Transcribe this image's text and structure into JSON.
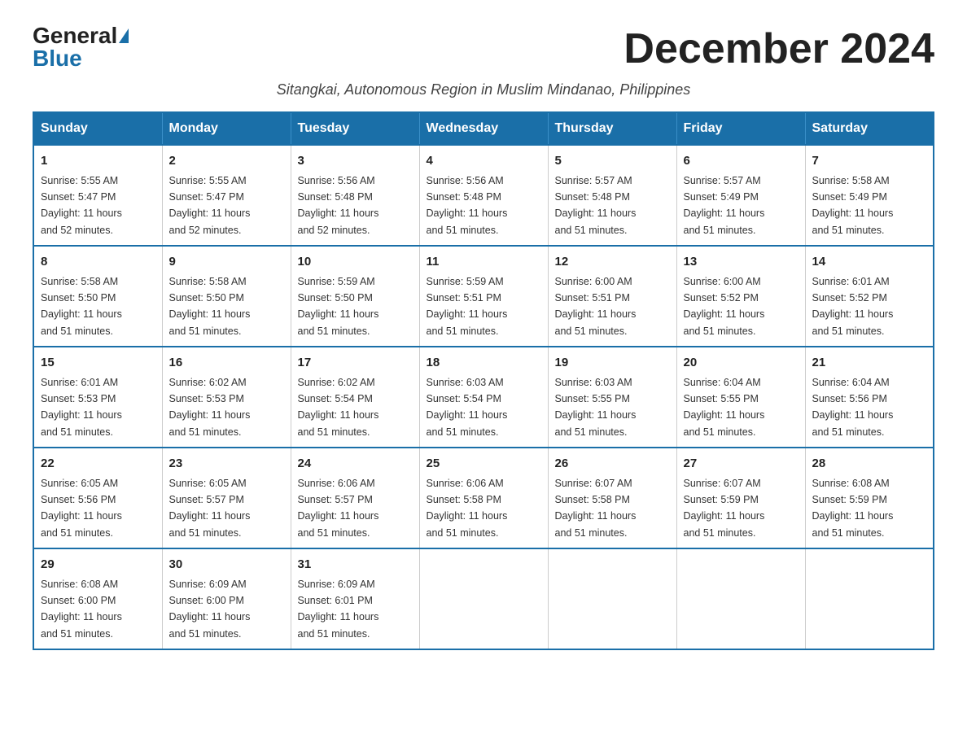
{
  "logo": {
    "general": "General",
    "blue": "Blue"
  },
  "title": "December 2024",
  "subtitle": "Sitangkai, Autonomous Region in Muslim Mindanao, Philippines",
  "days_of_week": [
    "Sunday",
    "Monday",
    "Tuesday",
    "Wednesday",
    "Thursday",
    "Friday",
    "Saturday"
  ],
  "weeks": [
    [
      {
        "day": "1",
        "sunrise": "5:55 AM",
        "sunset": "5:47 PM",
        "daylight": "11 hours and 52 minutes."
      },
      {
        "day": "2",
        "sunrise": "5:55 AM",
        "sunset": "5:47 PM",
        "daylight": "11 hours and 52 minutes."
      },
      {
        "day": "3",
        "sunrise": "5:56 AM",
        "sunset": "5:48 PM",
        "daylight": "11 hours and 52 minutes."
      },
      {
        "day": "4",
        "sunrise": "5:56 AM",
        "sunset": "5:48 PM",
        "daylight": "11 hours and 51 minutes."
      },
      {
        "day": "5",
        "sunrise": "5:57 AM",
        "sunset": "5:48 PM",
        "daylight": "11 hours and 51 minutes."
      },
      {
        "day": "6",
        "sunrise": "5:57 AM",
        "sunset": "5:49 PM",
        "daylight": "11 hours and 51 minutes."
      },
      {
        "day": "7",
        "sunrise": "5:58 AM",
        "sunset": "5:49 PM",
        "daylight": "11 hours and 51 minutes."
      }
    ],
    [
      {
        "day": "8",
        "sunrise": "5:58 AM",
        "sunset": "5:50 PM",
        "daylight": "11 hours and 51 minutes."
      },
      {
        "day": "9",
        "sunrise": "5:58 AM",
        "sunset": "5:50 PM",
        "daylight": "11 hours and 51 minutes."
      },
      {
        "day": "10",
        "sunrise": "5:59 AM",
        "sunset": "5:50 PM",
        "daylight": "11 hours and 51 minutes."
      },
      {
        "day": "11",
        "sunrise": "5:59 AM",
        "sunset": "5:51 PM",
        "daylight": "11 hours and 51 minutes."
      },
      {
        "day": "12",
        "sunrise": "6:00 AM",
        "sunset": "5:51 PM",
        "daylight": "11 hours and 51 minutes."
      },
      {
        "day": "13",
        "sunrise": "6:00 AM",
        "sunset": "5:52 PM",
        "daylight": "11 hours and 51 minutes."
      },
      {
        "day": "14",
        "sunrise": "6:01 AM",
        "sunset": "5:52 PM",
        "daylight": "11 hours and 51 minutes."
      }
    ],
    [
      {
        "day": "15",
        "sunrise": "6:01 AM",
        "sunset": "5:53 PM",
        "daylight": "11 hours and 51 minutes."
      },
      {
        "day": "16",
        "sunrise": "6:02 AM",
        "sunset": "5:53 PM",
        "daylight": "11 hours and 51 minutes."
      },
      {
        "day": "17",
        "sunrise": "6:02 AM",
        "sunset": "5:54 PM",
        "daylight": "11 hours and 51 minutes."
      },
      {
        "day": "18",
        "sunrise": "6:03 AM",
        "sunset": "5:54 PM",
        "daylight": "11 hours and 51 minutes."
      },
      {
        "day": "19",
        "sunrise": "6:03 AM",
        "sunset": "5:55 PM",
        "daylight": "11 hours and 51 minutes."
      },
      {
        "day": "20",
        "sunrise": "6:04 AM",
        "sunset": "5:55 PM",
        "daylight": "11 hours and 51 minutes."
      },
      {
        "day": "21",
        "sunrise": "6:04 AM",
        "sunset": "5:56 PM",
        "daylight": "11 hours and 51 minutes."
      }
    ],
    [
      {
        "day": "22",
        "sunrise": "6:05 AM",
        "sunset": "5:56 PM",
        "daylight": "11 hours and 51 minutes."
      },
      {
        "day": "23",
        "sunrise": "6:05 AM",
        "sunset": "5:57 PM",
        "daylight": "11 hours and 51 minutes."
      },
      {
        "day": "24",
        "sunrise": "6:06 AM",
        "sunset": "5:57 PM",
        "daylight": "11 hours and 51 minutes."
      },
      {
        "day": "25",
        "sunrise": "6:06 AM",
        "sunset": "5:58 PM",
        "daylight": "11 hours and 51 minutes."
      },
      {
        "day": "26",
        "sunrise": "6:07 AM",
        "sunset": "5:58 PM",
        "daylight": "11 hours and 51 minutes."
      },
      {
        "day": "27",
        "sunrise": "6:07 AM",
        "sunset": "5:59 PM",
        "daylight": "11 hours and 51 minutes."
      },
      {
        "day": "28",
        "sunrise": "6:08 AM",
        "sunset": "5:59 PM",
        "daylight": "11 hours and 51 minutes."
      }
    ],
    [
      {
        "day": "29",
        "sunrise": "6:08 AM",
        "sunset": "6:00 PM",
        "daylight": "11 hours and 51 minutes."
      },
      {
        "day": "30",
        "sunrise": "6:09 AM",
        "sunset": "6:00 PM",
        "daylight": "11 hours and 51 minutes."
      },
      {
        "day": "31",
        "sunrise": "6:09 AM",
        "sunset": "6:01 PM",
        "daylight": "11 hours and 51 minutes."
      },
      null,
      null,
      null,
      null
    ]
  ],
  "labels": {
    "sunrise": "Sunrise:",
    "sunset": "Sunset:",
    "daylight": "Daylight:"
  }
}
